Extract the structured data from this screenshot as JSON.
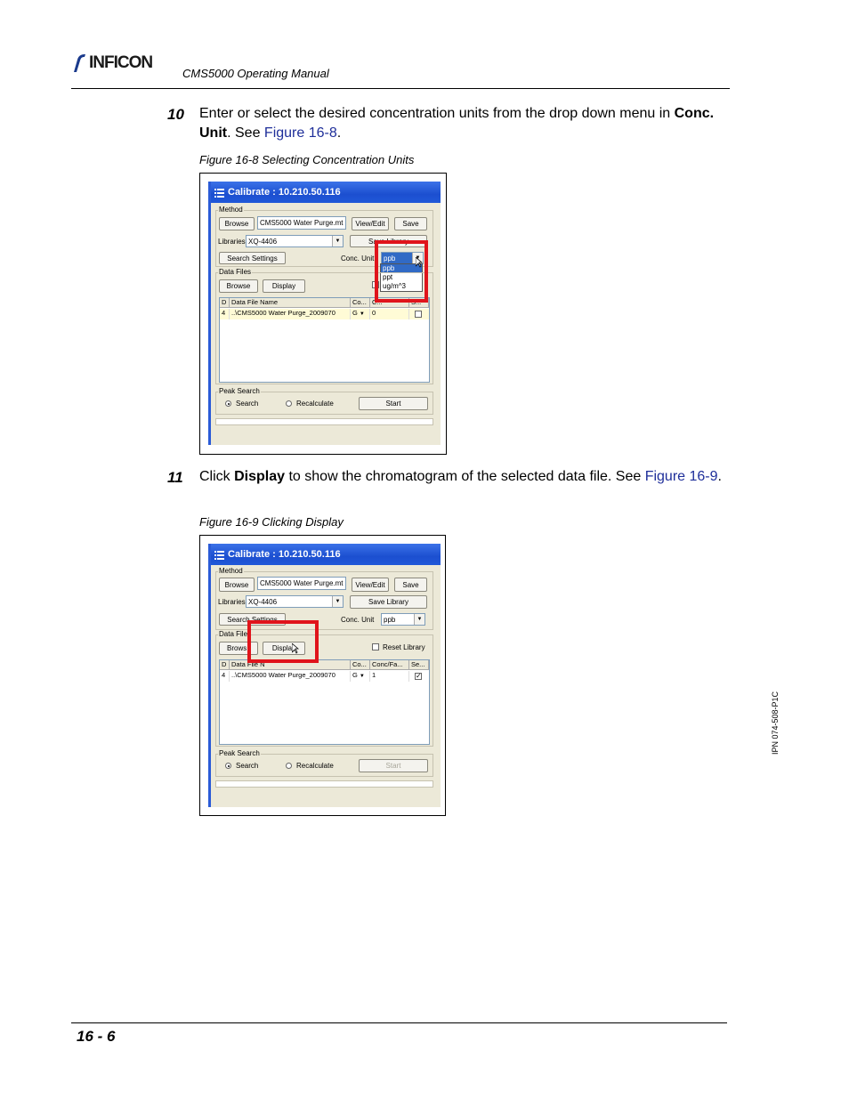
{
  "header": {
    "brand": "INFICON",
    "title": "CMS5000 Operating Manual"
  },
  "steps": [
    {
      "number": "10",
      "text_before": "Enter or select the desired concentration units from the drop down menu in ",
      "bold": "Conc. Unit",
      "text_mid": ". See ",
      "link": "Figure 16-8",
      "text_after": "."
    },
    {
      "number": "11",
      "text_before": "Click ",
      "bold": "Display",
      "text_mid": " to show the chromatogram of the selected data file. See ",
      "link": "Figure 16-9",
      "text_after": "."
    }
  ],
  "figures": [
    {
      "caption": "Figure 16-8  Selecting Concentration Units",
      "window": {
        "title": "Calibrate : 10.210.50.116",
        "method_label": "Method",
        "browse": "Browse",
        "method_file": "CMS5000 Water Purge.mt",
        "view_edit": "View/Edit",
        "save": "Save",
        "libraries_label": "Libraries",
        "library_value": "XQ-4406",
        "save_library": "Save Library",
        "search_settings": "Search Settings",
        "conc_unit_label": "Conc. Unit",
        "conc_unit_value": "ppb",
        "dropdown_options": [
          "ppb",
          "ppt",
          "ug/m^3"
        ],
        "data_files_label": "Data Files",
        "display": "Display",
        "reset_library": "",
        "grid_headers": [
          "D",
          "Data File Name",
          "Co...",
          "C...",
          "S..."
        ],
        "row": [
          "4",
          "..\\CMS5000 Water Purge_2009070",
          "G",
          "0",
          ""
        ],
        "peak_search_label": "Peak Search",
        "search": "Search",
        "recalculate": "Recalculate",
        "start": "Start"
      }
    },
    {
      "caption": "Figure 16-9  Clicking Display",
      "window": {
        "title": "Calibrate : 10.210.50.116",
        "method_label": "Method",
        "browse": "Browse",
        "method_file": "CMS5000 Water Purge.mt",
        "view_edit": "View/Edit",
        "save": "Save",
        "libraries_label": "Libraries",
        "library_value": "XQ-4406",
        "save_library": "Save Library",
        "search_settings": "Search Settings",
        "conc_unit_label": "Conc. Unit",
        "conc_unit_value": "ppb",
        "data_files_label": "Data File",
        "browse_partial": "Brows",
        "display": "Display",
        "reset_library": "Reset Library",
        "grid_headers": [
          "D",
          "Data File N",
          "Co...",
          "Conc/Fa...",
          "Se..."
        ],
        "row": [
          "4",
          "..\\CMS5000 Water Purge_2009070",
          "G",
          "1",
          "✓"
        ],
        "peak_search_label": "Peak Search",
        "search": "Search",
        "recalculate": "Recalculate",
        "start": "Start"
      }
    }
  ],
  "footer": {
    "page_number": "16 - 6",
    "ipn": "IPN 074-508-P1C"
  },
  "colors": {
    "link": "#1f2f9a",
    "highlight": "#e0141b",
    "titlebar": "#1c4fd0"
  }
}
